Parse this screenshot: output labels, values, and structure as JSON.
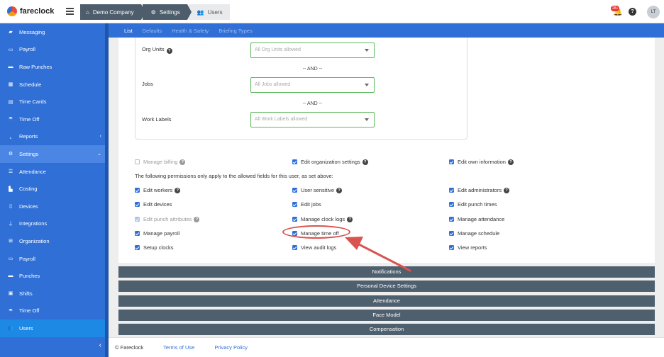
{
  "brand": {
    "name": "fareclock"
  },
  "breadcrumb": [
    {
      "label": "Demo Company",
      "icon": "home-icon"
    },
    {
      "label": "Settings",
      "icon": "gear-icon"
    },
    {
      "label": "Users",
      "icon": "users-icon"
    }
  ],
  "header": {
    "notification_count": "28+",
    "help": "?",
    "avatar_initials": "LT"
  },
  "sidebar": {
    "items": [
      {
        "label": "Messaging",
        "icon": "message-icon"
      },
      {
        "label": "Payroll",
        "icon": "money-icon"
      },
      {
        "label": "Raw Punches",
        "icon": "car-icon"
      },
      {
        "label": "Schedule",
        "icon": "calendar-icon"
      },
      {
        "label": "Time Cards",
        "icon": "card-icon"
      },
      {
        "label": "Time Off",
        "icon": "beach-icon"
      },
      {
        "label": "Reports",
        "icon": "chart-icon"
      },
      {
        "label": "Settings",
        "icon": "gear-icon"
      },
      {
        "label": "Attendance",
        "icon": "list-icon"
      },
      {
        "label": "Costing",
        "icon": "costing-icon"
      },
      {
        "label": "Devices",
        "icon": "device-icon"
      },
      {
        "label": "Integrations",
        "icon": "plug-icon"
      },
      {
        "label": "Organization",
        "icon": "org-icon"
      },
      {
        "label": "Payroll",
        "icon": "money-icon"
      },
      {
        "label": "Punches",
        "icon": "car-icon"
      },
      {
        "label": "Shifts",
        "icon": "clipboard-icon"
      },
      {
        "label": "Time Off",
        "icon": "beach-icon"
      },
      {
        "label": "Users",
        "icon": "users-icon"
      }
    ],
    "collapse_glyph": "‹"
  },
  "tabs": [
    "List",
    "Defaults",
    "Health & Safety",
    "Briefing Types"
  ],
  "filters": {
    "org_units_label": "Org Units",
    "org_units_placeholder": "All Org Units allowed",
    "and_1": "-- AND --",
    "jobs_label": "Jobs",
    "jobs_placeholder": "All Jobs allowed",
    "and_2": "-- AND --",
    "work_labels_label": "Work Labels",
    "work_labels_placeholder": "All Work Labels allowed"
  },
  "permissions": {
    "manage_billing": "Manage billing",
    "edit_org_settings": "Edit organization settings",
    "edit_own_info": "Edit own information",
    "note": "The following permissions only apply to the allowed fields for this user, as set above:",
    "edit_workers": "Edit workers",
    "user_sensitive": "User sensitive",
    "edit_administrators": "Edit administrators",
    "edit_devices": "Edit devices",
    "edit_jobs": "Edit jobs",
    "edit_punch_times": "Edit punch times",
    "edit_punch_attributes": "Edit punch attributes",
    "manage_clock_logs": "Manage clock logs",
    "manage_attendance": "Manage attendance",
    "manage_payroll": "Manage payroll",
    "manage_time_off": "Manage time off",
    "manage_schedule": "Manage schedule",
    "setup_clocks": "Setup clocks",
    "view_audit_logs": "View audit logs",
    "view_reports": "View reports"
  },
  "sections": [
    "Notifications",
    "Personal Device Settings",
    "Attendance",
    "Face Model",
    "Compensation"
  ],
  "footer": {
    "copyright": "© Fareclock",
    "terms": "Terms of Use",
    "privacy": "Privacy Policy"
  },
  "colors": {
    "accent": "#2f6fd6",
    "section_bar": "#4e5f6e",
    "highlight": "#d9534f"
  }
}
